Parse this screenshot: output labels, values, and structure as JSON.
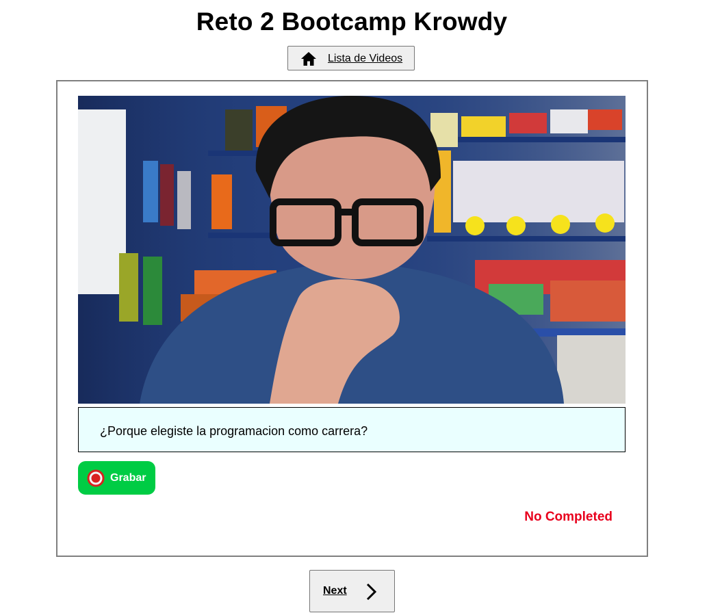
{
  "header": {
    "title": "Reto 2 Bootcamp Krowdy",
    "home_button_label": "Lista de Videos",
    "home_icon": "home-icon"
  },
  "video": {
    "description": "webcam-preview"
  },
  "question": {
    "text": "¿Porque elegiste la programacion como carrera?"
  },
  "record": {
    "label": "Grabar",
    "icon": "record-icon"
  },
  "status": {
    "text": "No Completed",
    "color": "#e8001d"
  },
  "navigation": {
    "next_label": "Next",
    "next_icon": "chevron-right-icon"
  },
  "colors": {
    "record_button": "#00cc44",
    "question_background": "#eaffff"
  }
}
